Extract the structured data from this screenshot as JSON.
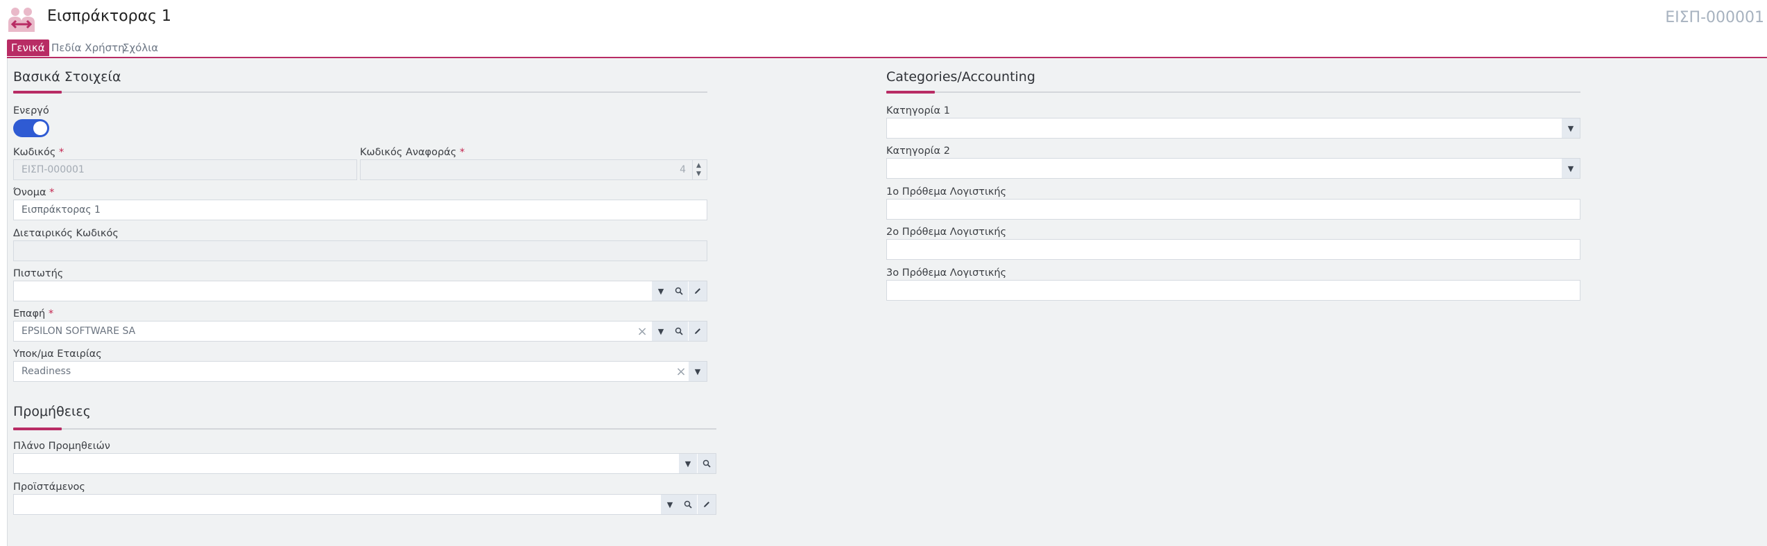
{
  "header": {
    "title": "Εισπράκτορας 1",
    "code": "ΕΙΣΠ-000001",
    "logo_icon": "people-exchange-icon",
    "accent": "#b82c64"
  },
  "tabs": [
    {
      "label": "Γενικά",
      "active": true
    },
    {
      "label": "Πεδία Χρήστη",
      "active": false
    },
    {
      "label": "Σχόλια",
      "active": false
    }
  ],
  "basic": {
    "title": "Βασικά Στοιχεία",
    "active_label": "Ενεργό",
    "active_value": true,
    "code_label": "Κωδικός",
    "code_value": "ΕΙΣΠ-000001",
    "ref_code_label": "Κωδικός Αναφοράς",
    "ref_code_value": "4",
    "name_label": "Όνομα",
    "name_value": "Εισπράκτορας 1",
    "intl_code_label": "Διεταιρικός Κωδικός",
    "intl_code_value": "",
    "creditor_label": "Πιστωτής",
    "creditor_value": "",
    "contact_label": "Επαφή",
    "contact_value": "EPSILON SOFTWARE SA",
    "branch_label": "Υποκ/μα Εταιρίας",
    "branch_value": "Readiness",
    "required_mark": "*"
  },
  "commissions": {
    "title": "Προμήθειες",
    "plan_label": "Πλάνο Προμηθειών",
    "plan_value": "",
    "supervisor_label": "Προϊστάμενος",
    "supervisor_value": ""
  },
  "categories": {
    "title": "Categories/Accounting",
    "cat1_label": "Κατηγορία 1",
    "cat1_value": "",
    "cat2_label": "Κατηγορία 2",
    "cat2_value": "",
    "prefix1_label": "1ο Πρόθεμα Λογιστικής",
    "prefix1_value": "",
    "prefix2_label": "2ο Πρόθεμα Λογιστικής",
    "prefix2_value": "",
    "prefix3_label": "3ο Πρόθεμα Λογιστικής",
    "prefix3_value": ""
  },
  "glyphs": {
    "dropdown": "▼",
    "clear": "×",
    "spin_up": "▲",
    "spin_down": "▼"
  }
}
